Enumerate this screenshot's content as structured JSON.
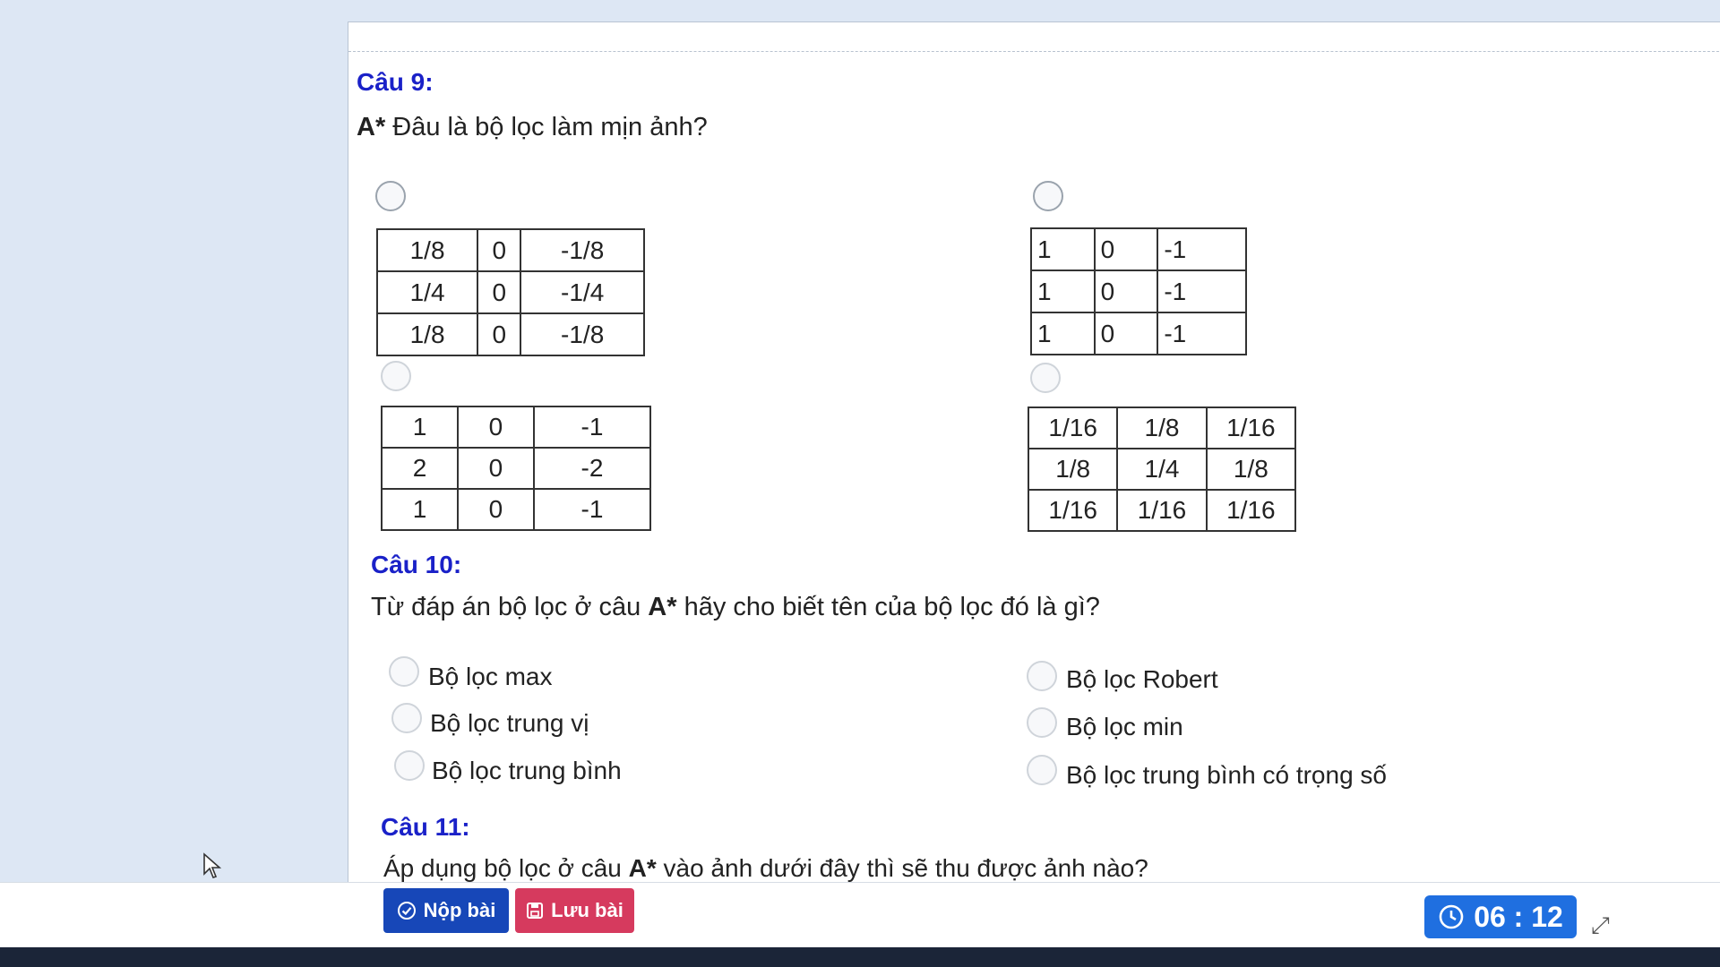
{
  "questions": {
    "q9": {
      "title": "Câu 9:",
      "text_prefix": "A*",
      "text": " Đâu là bộ lọc làm mịn ảnh?",
      "options": [
        {
          "matrix": [
            [
              "1/8",
              "0",
              "-1/8"
            ],
            [
              "1/4",
              "0",
              "-1/4"
            ],
            [
              "1/8",
              "0",
              "-1/8"
            ]
          ]
        },
        {
          "matrix": [
            [
              "1",
              "0",
              "-1"
            ],
            [
              "1",
              "0",
              "-1"
            ],
            [
              "1",
              "0",
              "-1"
            ]
          ]
        },
        {
          "matrix": [
            [
              "1",
              "0",
              "-1"
            ],
            [
              "2",
              "0",
              "-2"
            ],
            [
              "1",
              "0",
              "-1"
            ]
          ]
        },
        {
          "matrix": [
            [
              "1/16",
              "1/8",
              "1/16"
            ],
            [
              "1/8",
              "1/4",
              "1/8"
            ],
            [
              "1/16",
              "1/16",
              "1/16"
            ]
          ]
        }
      ]
    },
    "q10": {
      "title": "Câu 10:",
      "text_a": "Từ đáp án bộ lọc ở câu ",
      "text_b": "A*",
      "text_c": " hãy cho biết tên của bộ lọc đó là gì?",
      "options": [
        "Bộ lọc max",
        "Bộ lọc Robert",
        "Bộ lọc trung vị",
        "Bộ lọc min",
        "Bộ lọc trung bình",
        "Bộ lọc trung bình có trọng số"
      ]
    },
    "q11": {
      "title": "Câu 11:",
      "text_a": "Áp dụng bộ lọc ở câu ",
      "text_b": "A*",
      "text_c": " vào ảnh dưới đây thì sẽ thu được ảnh nào?"
    }
  },
  "footer": {
    "submit_label": "Nộp bài",
    "save_label": "Lưu bài",
    "timer": "06 : 12"
  },
  "colors": {
    "title": "#1a21c8",
    "submit": "#1747b8",
    "save": "#d63a5e",
    "timer": "#1f6fe0"
  },
  "icons": [
    "check-circle-icon",
    "floppy-disk-icon",
    "clock-icon",
    "expand-icon",
    "mouse-cursor-icon"
  ]
}
